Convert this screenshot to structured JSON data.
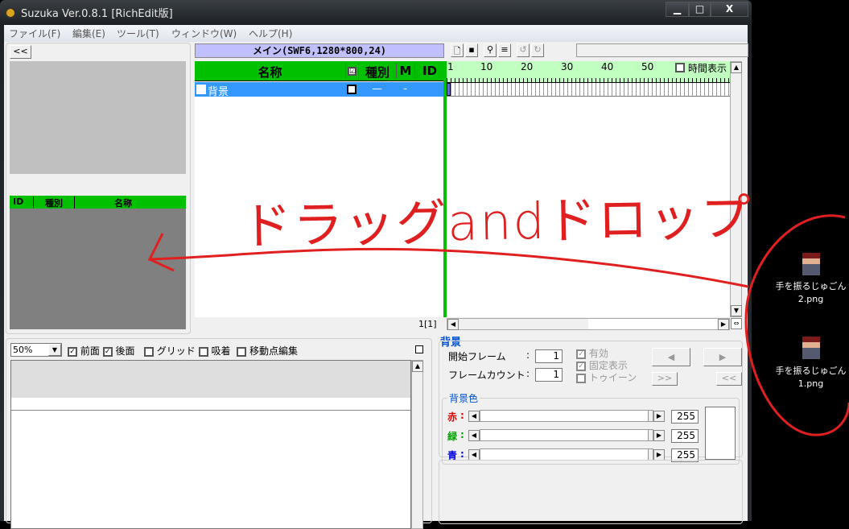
{
  "window": {
    "title": "Suzuka Ver.0.8.1 [RichEdit版]",
    "minimize": "▁",
    "maximize": "□",
    "close": "X"
  },
  "menu": [
    "ファイル(F)",
    "編集(E)",
    "ツール(T)",
    "ウィンドウ(W)",
    "ヘルプ(H)"
  ],
  "left": {
    "collapse_label": "<<",
    "columns": [
      "ID",
      "種別",
      "名称"
    ]
  },
  "main": {
    "title": "メイン(SWF6,1280*800,24)",
    "columns": [
      "名称",
      "☑",
      "種別",
      "M",
      "ID"
    ],
    "rows": [
      {
        "name": "背景",
        "checked": true,
        "type": "—",
        "m": "-",
        "id": ""
      }
    ],
    "frame_indicator": "1[1]"
  },
  "timeline": {
    "ticks": [
      "1",
      "10",
      "20",
      "30",
      "40",
      "50"
    ],
    "time_display_label": "時間表示",
    "time_display_checked": false
  },
  "stage": {
    "zoom": "50%",
    "options": [
      {
        "label": "前面",
        "checked": true
      },
      {
        "label": "後面",
        "checked": true
      },
      {
        "label": "グリッド",
        "checked": false
      },
      {
        "label": "吸着",
        "checked": false
      },
      {
        "label": "移動点編集",
        "checked": false
      }
    ]
  },
  "props": {
    "title": "背景",
    "start_frame_label": "開始フレーム",
    "start_frame": "1",
    "frame_count_label": "フレームカウント",
    "frame_count": "1",
    "enabled": "有効",
    "fixed": "固定表示",
    "tween": "トゥイーン",
    "prev": "◀",
    "next": "▶",
    "ff": ">>",
    "rw": "<<",
    "bg_color_label": "背景色",
    "colors": [
      {
        "label": "赤",
        "value": "255",
        "color": "#e00000"
      },
      {
        "label": "緑",
        "value": "255",
        "color": "#00a000"
      },
      {
        "label": "青",
        "value": "255",
        "color": "#0000e0"
      }
    ]
  },
  "annotation": {
    "text": "ドラッグandドロップ",
    "color": "#e02020"
  },
  "desktop": {
    "icons": [
      {
        "name": "手を振るじゅごん",
        "ext": "2.png"
      },
      {
        "name": "手を振るじゅごん",
        "ext": "1.png"
      }
    ]
  }
}
